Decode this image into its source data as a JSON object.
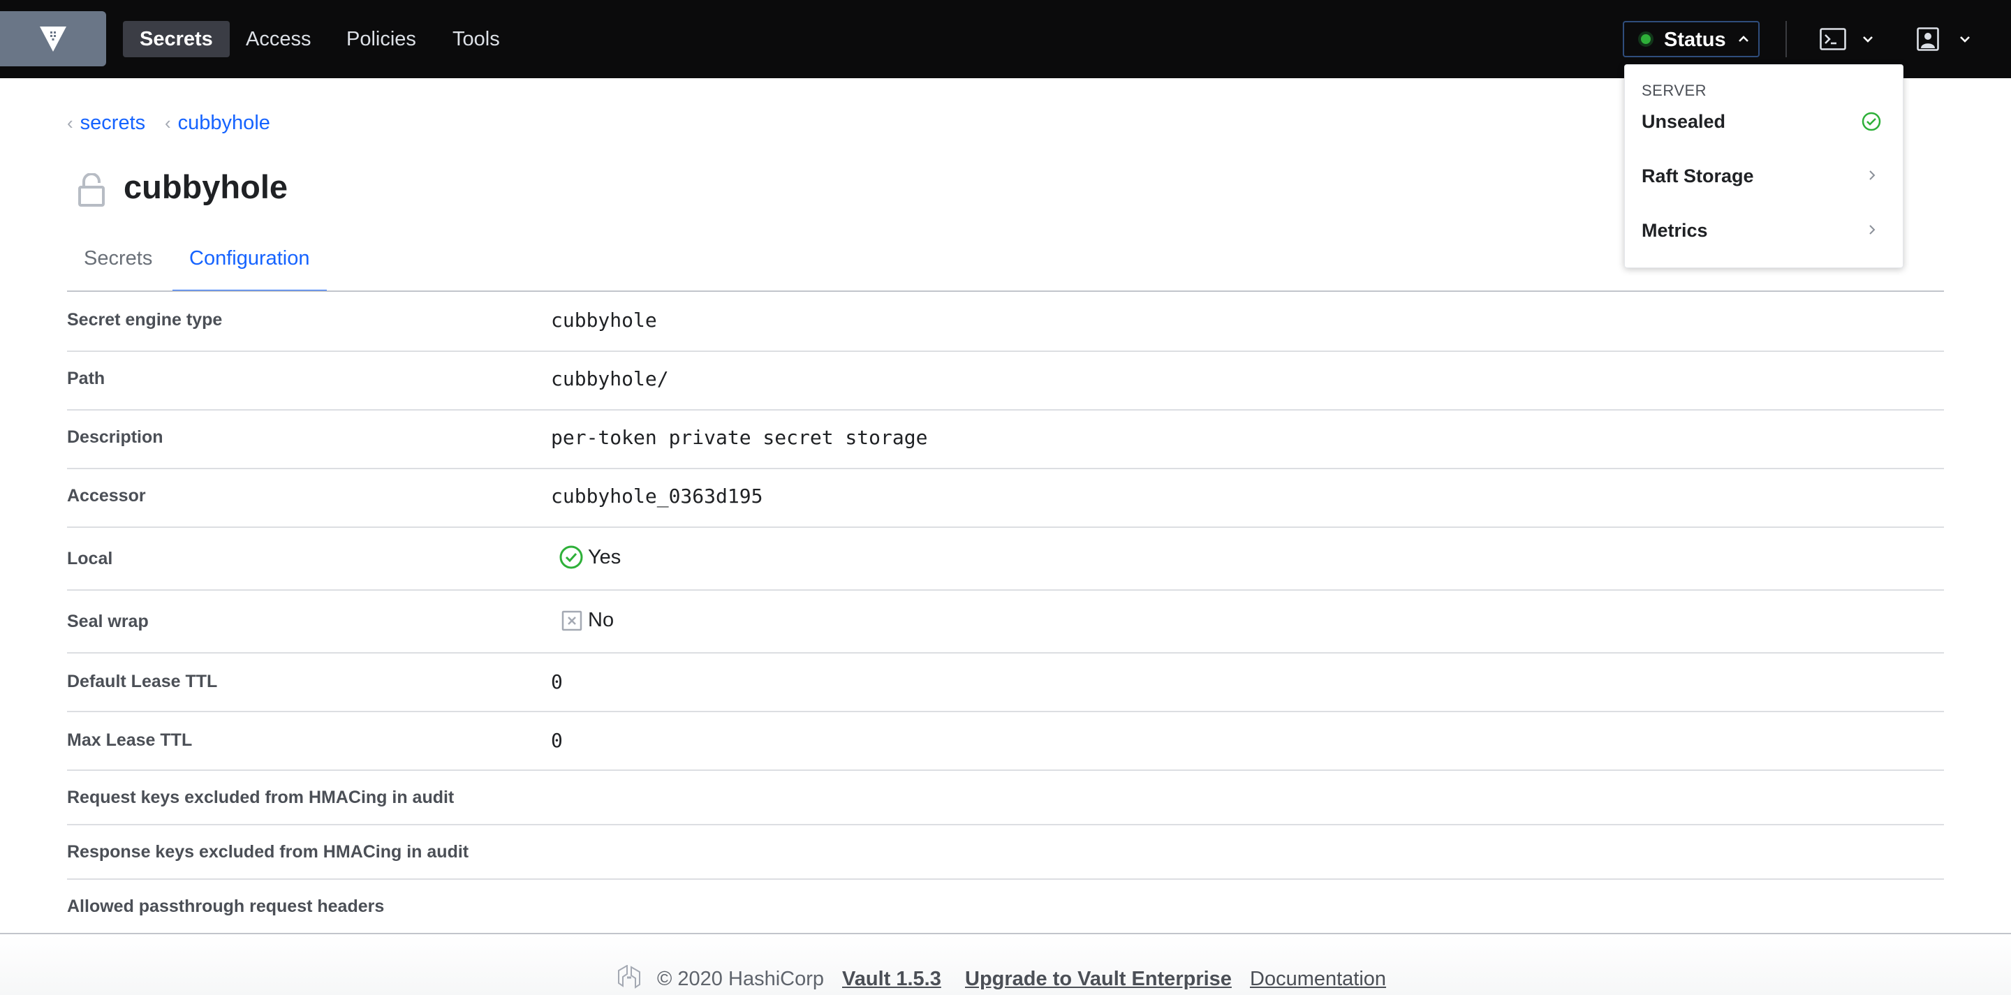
{
  "nav": {
    "logo_icon": "vault-logo-icon",
    "links": [
      "Secrets",
      "Access",
      "Policies",
      "Tools"
    ],
    "active": "Secrets",
    "status_label": "Status",
    "status_color": "#2eb039"
  },
  "status_menu": {
    "header": "SERVER",
    "items": [
      {
        "label": "Unsealed",
        "icon": "check-circle-icon"
      },
      {
        "label": "Raft Storage",
        "icon": "chevron-right-icon"
      },
      {
        "label": "Metrics",
        "icon": "chevron-right-icon"
      }
    ]
  },
  "breadcrumb": [
    "secrets",
    "cubbyhole"
  ],
  "page": {
    "title": "cubbyhole",
    "title_icon": "lock-icon"
  },
  "tabs": [
    {
      "label": "Secrets",
      "active": false
    },
    {
      "label": "Configuration",
      "active": true
    }
  ],
  "config_rows": [
    {
      "label": "Secret engine type",
      "value": "cubbyhole"
    },
    {
      "label": "Path",
      "value": "cubbyhole/"
    },
    {
      "label": "Description",
      "value": "per-token private secret storage"
    },
    {
      "label": "Accessor",
      "value": "cubbyhole_0363d195"
    },
    {
      "label": "Local",
      "value": "Yes",
      "icon": "check-circle-icon"
    },
    {
      "label": "Seal wrap",
      "value": "No",
      "icon": "x-square-icon"
    },
    {
      "label": "Default Lease TTL",
      "value": "0"
    },
    {
      "label": "Max Lease TTL",
      "value": "0"
    },
    {
      "label": "Request keys excluded from HMACing in audit",
      "value": ""
    },
    {
      "label": "Response keys excluded from HMACing in audit",
      "value": ""
    },
    {
      "label": "Allowed passthrough request headers",
      "value": ""
    }
  ],
  "footer": {
    "copyright": "© 2020 HashiCorp",
    "version": "Vault 1.5.3",
    "upgrade": "Upgrade to Vault Enterprise",
    "docs": "Documentation"
  },
  "colors": {
    "accent": "#1563ff",
    "success": "#2eb039",
    "nav_bg": "#0b0b0c"
  }
}
